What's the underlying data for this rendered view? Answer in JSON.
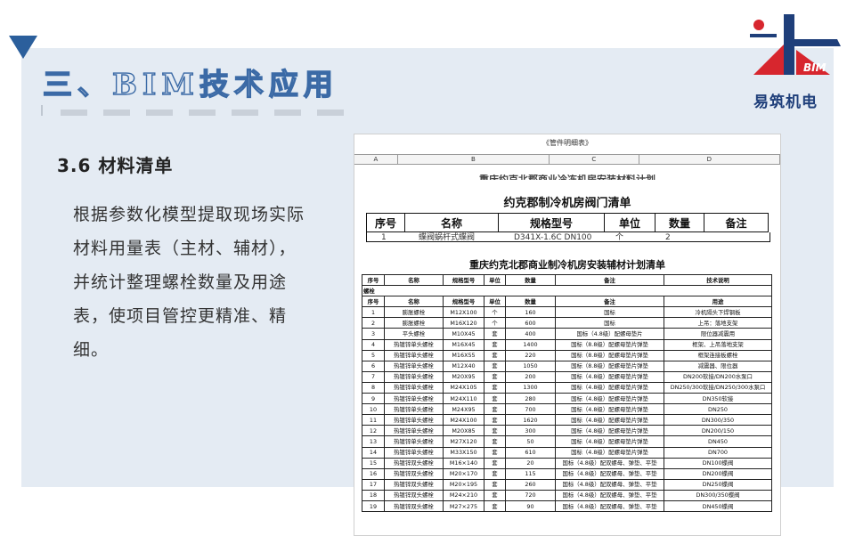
{
  "slide": {
    "section_title": "三、BIM技术应用",
    "subtitle": "3.6 材料清单",
    "body": "根据参数化模型提取现场实际材料用量表（主材、辅材），并统计整理螺栓数量及用途表，使项目管控更精准、精细。",
    "logo_text": "易筑机电",
    "logo_mark": "BIM",
    "colors": {
      "accent": "#2b5f9c",
      "panel": "#e4ebf3",
      "logo_red": "#d7262e",
      "logo_blue": "#1f3f7a"
    }
  },
  "sheet": {
    "caption": "《管件明细表》",
    "columns": [
      "A",
      "B",
      "C",
      "D"
    ],
    "cut_title": "重庆约克北郡商业冷冻机房安装材料计划清单",
    "valve_title": "约克郡制冷机房阀门清单",
    "valve_headers": [
      "序号",
      "名称",
      "规格型号",
      "单位",
      "数量",
      "备注"
    ],
    "valve_partial_row": [
      "1",
      "蝶阀蜗杆式蝶阀",
      "D341X-1.6C DN100",
      "个",
      "2",
      ""
    ],
    "material_title": "重庆约克北郡商业制冷机房安装辅材计划清单",
    "material_headers": [
      "序号",
      "名称",
      "规格型号",
      "单位",
      "数量",
      "备注",
      "技术说明"
    ],
    "group_label": "螺栓",
    "bolt_headers": [
      "序号",
      "名称",
      "规格型号",
      "单位",
      "数量",
      "备注",
      "用途"
    ],
    "rows": [
      [
        "1",
        "膨胀螺栓",
        "M12X100",
        "个",
        "160",
        "国标",
        "冷机隔头下焊钢板"
      ],
      [
        "2",
        "膨胀螺栓",
        "M16X120",
        "个",
        "600",
        "国标",
        "上吊：落地支架"
      ],
      [
        "3",
        "平头螺栓",
        "M10X45",
        "套",
        "400",
        "国标（4.8级）配螺母垫片",
        "限位器减震用"
      ],
      [
        "4",
        "热镀锌单头螺栓",
        "M16X45",
        "套",
        "1400",
        "国标（8.8级）配螺母垫片弹垫",
        "框架、上吊落地支架"
      ],
      [
        "5",
        "热镀锌单头螺栓",
        "M16X55",
        "套",
        "220",
        "国标（8.8级）配螺母垫片弹垫",
        "框架连接板螺栓"
      ],
      [
        "6",
        "热镀锌单头螺栓",
        "M12X40",
        "套",
        "1050",
        "国标（8.8级）配螺母垫片弹垫",
        "减震器、限位器"
      ],
      [
        "7",
        "热镀锌单头螺栓",
        "M20X95",
        "套",
        "200",
        "国标（4.8级）配螺母垫片弹垫",
        "DN200软接/DN200水泵口"
      ],
      [
        "8",
        "热镀锌单头螺栓",
        "M24X105",
        "套",
        "1300",
        "国标（4.8级）配螺母垫片弹垫",
        "DN250/300软接/DN250/300水泵口"
      ],
      [
        "9",
        "热镀锌单头螺栓",
        "M24X110",
        "套",
        "280",
        "国标（4.8级）配螺母垫片弹垫",
        "DN350软接"
      ],
      [
        "10",
        "热镀锌单头螺栓",
        "M24X95",
        "套",
        "700",
        "国标（4.8级）配螺母垫片弹垫",
        "DN250"
      ],
      [
        "11",
        "热镀锌单头螺栓",
        "M24X100",
        "套",
        "1620",
        "国标（4.8级）配螺母垫片弹垫",
        "DN300/350"
      ],
      [
        "12",
        "热镀锌单头螺栓",
        "M20X85",
        "套",
        "300",
        "国标（4.8级）配螺母垫片弹垫",
        "DN200/150"
      ],
      [
        "13",
        "热镀锌单头螺栓",
        "M27X120",
        "套",
        "50",
        "国标（4.8级）配螺母垫片弹垫",
        "DN450"
      ],
      [
        "14",
        "热镀锌单头螺栓",
        "M33X150",
        "套",
        "610",
        "国标（4.8级）配螺母垫片弹垫",
        "DN700"
      ],
      [
        "15",
        "热镀锌双头螺栓",
        "M16×140",
        "套",
        "20",
        "国标（4.8级）配双螺母、弹垫、平垫",
        "DN100蝶阀"
      ],
      [
        "16",
        "热镀锌双头螺栓",
        "M20×170",
        "套",
        "115",
        "国标（4.8级）配双螺母、弹垫、平垫",
        "DN200蝶阀"
      ],
      [
        "17",
        "热镀锌双头螺栓",
        "M20×195",
        "套",
        "260",
        "国标（4.8级）配双螺母、弹垫、平垫",
        "DN250蝶阀"
      ],
      [
        "18",
        "热镀锌双头螺栓",
        "M24×210",
        "套",
        "720",
        "国标（4.8级）配双螺母、弹垫、平垫",
        "DN300/350蝶阀"
      ],
      [
        "19",
        "热镀锌双头螺栓",
        "M27×275",
        "套",
        "90",
        "国标（4.8级）配双螺母、弹垫、平垫",
        "DN450蝶阀"
      ]
    ]
  }
}
